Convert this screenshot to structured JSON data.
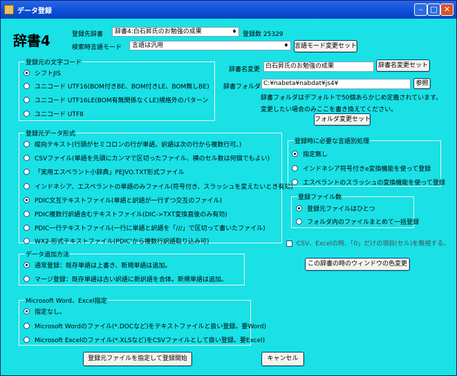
{
  "window": {
    "title": "データ登録",
    "controls": [
      "minimize-icon",
      "maximize-icon",
      "close-icon"
    ]
  },
  "header": {
    "big_label": "辞書4",
    "dest_label": "登録先辞書",
    "dest_value": "辞書4:白石昇氏のお勉強の成果",
    "count_label": "登録数",
    "count_value": "25329",
    "search_mode_label": "検索時言語モード",
    "search_mode_value": "言語は汎用",
    "search_mode_button": "言語モード変更セット"
  },
  "dict_name": {
    "label": "辞書名変更",
    "value": "白石昇氏のお勉強の成果",
    "button": "辞書名変更セット"
  },
  "dict_folder": {
    "label": "辞書フォルダ",
    "value": "C:¥nabeta¥nabdat¥js4¥",
    "browse_button": "参照",
    "note1": "辞書フォルダはデフォルトで50個あらかじめ定義されています。",
    "note2": "変更したい場合のみここを書き換えてください。",
    "change_button": "フォルダ変更セット"
  },
  "charcode": {
    "title": "登録元の文字コード",
    "options": [
      "シフトJIS",
      "ユニコード UTF16(BOM付きBE、BOM付きLE、BOM無しBE)",
      "ユニコード UTF16LE(BOM有無関係なくLE)規格外のパターン",
      "ユニコード UTF8"
    ],
    "selected": 0
  },
  "dataformat": {
    "title": "登録元データ形式",
    "options": [
      "縦向テキスト(行頭がセミコロンの行が単語。訳語は次の行から複数行可。)",
      "CSVファイル(単語を先頭にカンマで区切ったファイル、横のセル数は何個でもよい)",
      "「実用エスペラント小辞典」PEJVO.TXT形式ファイル",
      "インドネシア、エスペラントの単語のみファイル(符号付き、スラッシュを変えたいとき有効)",
      "PDIC文互テキストファイル(単語と訳語が一行ずつ交互のファイル)",
      "PDIC複数行訳語含むテキストファイル(DIC->TXT変換直後のみ有効)",
      "PDIC一行テキストファイル(一行に単語と訳語を「///」で区切って書いたファイル)",
      "WX2-形式テキストファイル(PDIC'から複数行訳語取り込み可)"
    ],
    "selected": 4
  },
  "special": {
    "title": "登録時に必要な言語別処理",
    "options": [
      "指定無し",
      "インドネシア符号付きe変換機能を使って登録",
      "エスペラントのスラッシュの変換機能を使って登録"
    ],
    "selected": 0
  },
  "filecount": {
    "title": "登録ファイル数",
    "options": [
      "登録元ファイルはひとつ",
      "フォルダ内のファイルまとめて一括登録"
    ],
    "selected": 0
  },
  "csv_checkbox": {
    "label": "CSV、Excelの時、「0」だけの項目(セル)を無視する。",
    "checked": false
  },
  "color_button": "この辞書の時のウィンドウの色変更",
  "adddata": {
    "title": "データ追加方法",
    "options": [
      "通常登録：既存単語は上書き、新規単語は追加。",
      "マージ登録：既存単語は古い訳語に新訳語を合体。新規単語は追加。"
    ],
    "selected": 0
  },
  "office": {
    "title": "Microsoft Word、Excel指定",
    "options": [
      "指定なし。",
      "Microsoft Wordのファイル(*.DOCなど)をテキストファイルと扱い登録。要Word)",
      "Microsoft Excelのファイル(*.XLSなど)をCSVファイルとして扱い登録。要Excel)"
    ],
    "selected": 0
  },
  "buttons": {
    "start": "登録元ファイルを指定して登録開始",
    "cancel": "キャンセル"
  },
  "colors": {
    "background": "#19e1e6",
    "titlebar": "#0a4fd6"
  }
}
